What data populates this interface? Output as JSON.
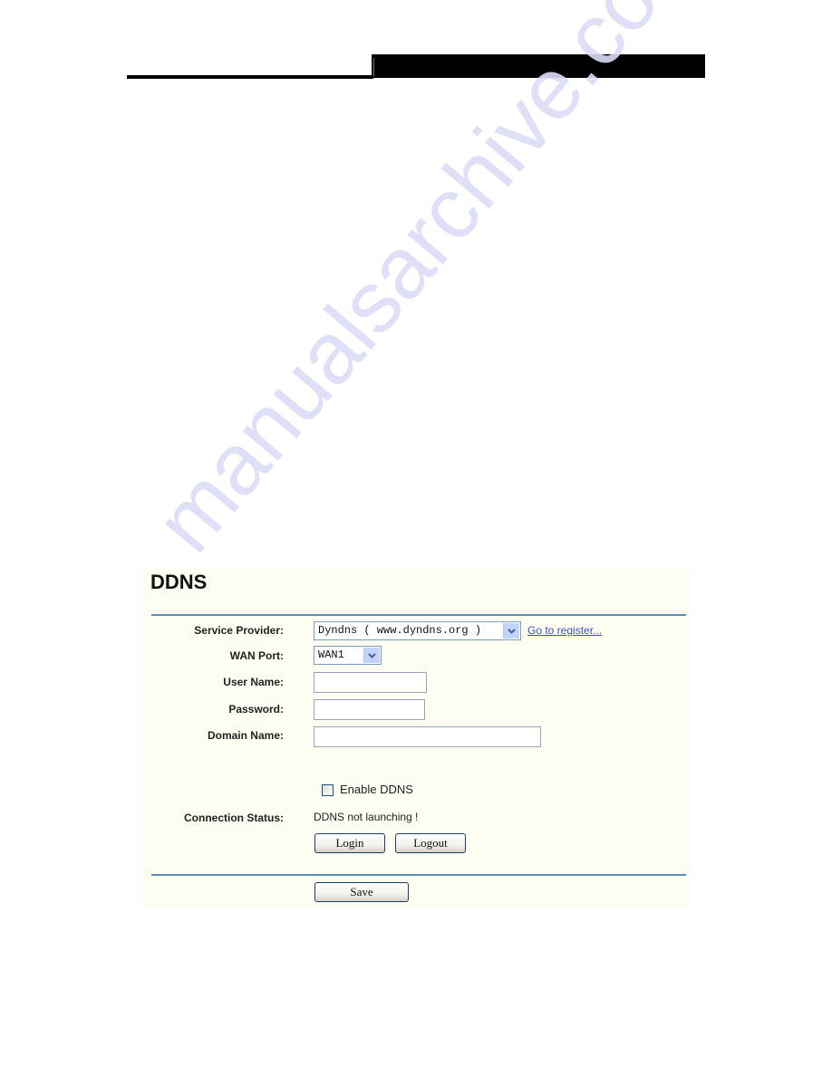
{
  "watermark": "manualsarchive.com",
  "colors": {
    "panel_background": "#fdfdf1",
    "rule": "#5a8fbb",
    "link": "#3c50c8",
    "header_bar": "#000000"
  },
  "panel": {
    "title": "DDNS",
    "fields": {
      "service_provider": {
        "label": "Service Provider:",
        "selected": "Dyndns ( www.dyndns.org )",
        "register_link": "Go to register..."
      },
      "wan_port": {
        "label": "WAN Port:",
        "selected": "WAN1"
      },
      "user_name": {
        "label": "User Name:",
        "value": ""
      },
      "password": {
        "label": "Password:",
        "value": ""
      },
      "domain_name": {
        "label": "Domain Name:",
        "value": ""
      }
    },
    "enable_ddns": {
      "label": "Enable DDNS",
      "checked": false
    },
    "connection_status": {
      "label": "Connection Status:",
      "value": "DDNS not launching !"
    },
    "buttons": {
      "login": "Login",
      "logout": "Logout",
      "save": "Save"
    }
  }
}
